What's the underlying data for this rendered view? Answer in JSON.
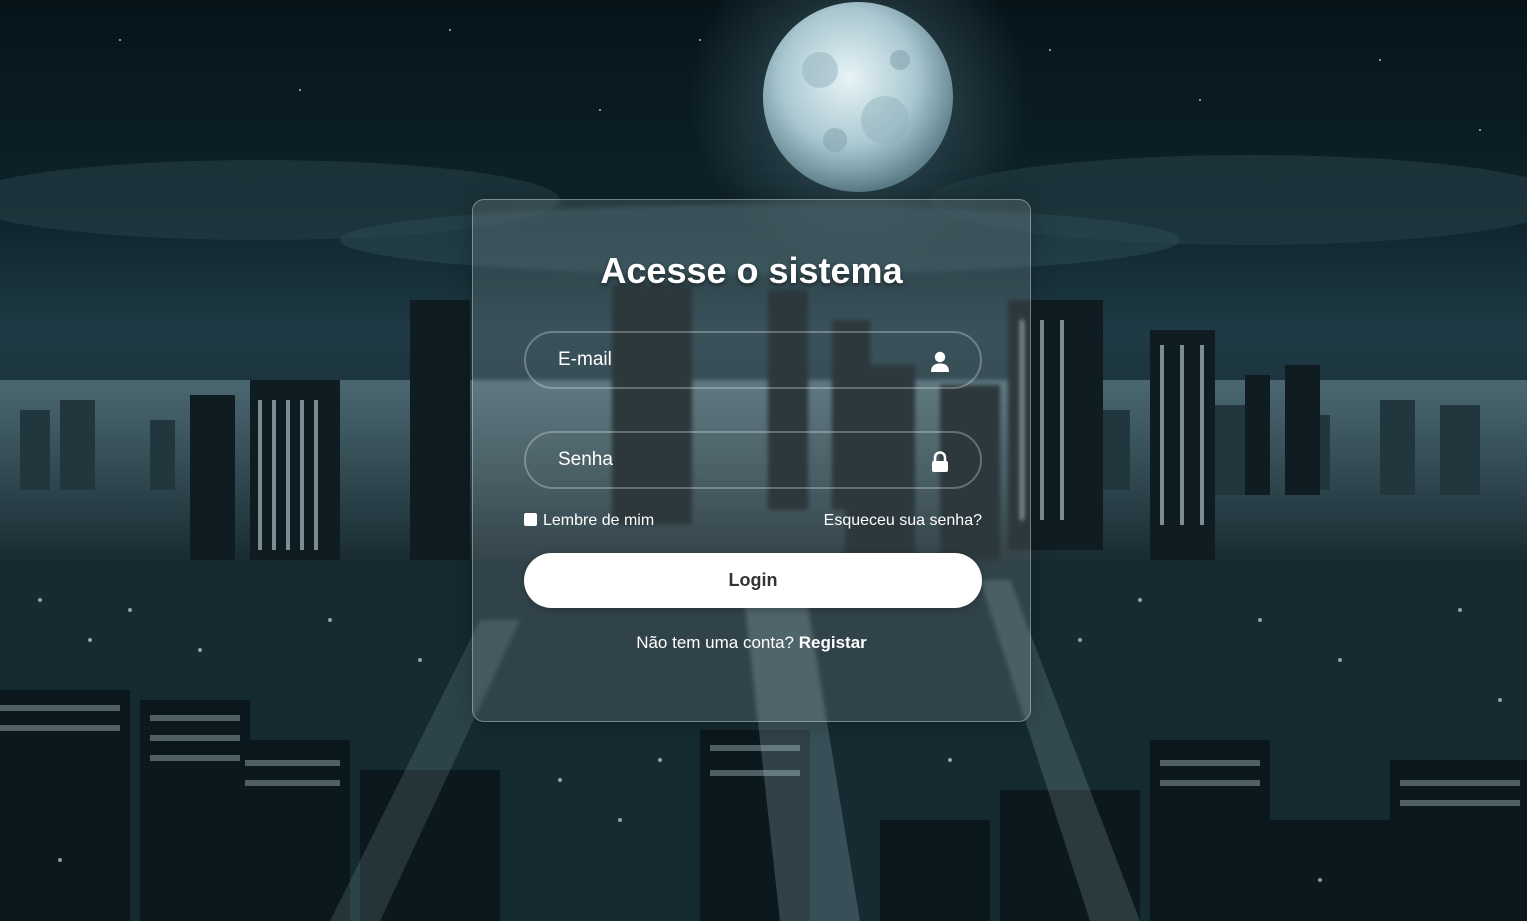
{
  "login_form": {
    "title": "Acesse o sistema",
    "email_placeholder": "E-mail",
    "password_placeholder": "Senha",
    "remember_label": "Lembre de mim",
    "forgot_link": "Esqueceu sua senha?",
    "login_button": "Login",
    "register_prompt": "Não tem uma conta?",
    "register_link": "Registar"
  },
  "icons": {
    "email_field": "user-icon",
    "password_field": "lock-icon"
  },
  "colors": {
    "button_background": "#ffffff",
    "button_text": "#333333",
    "text": "#ffffff"
  }
}
